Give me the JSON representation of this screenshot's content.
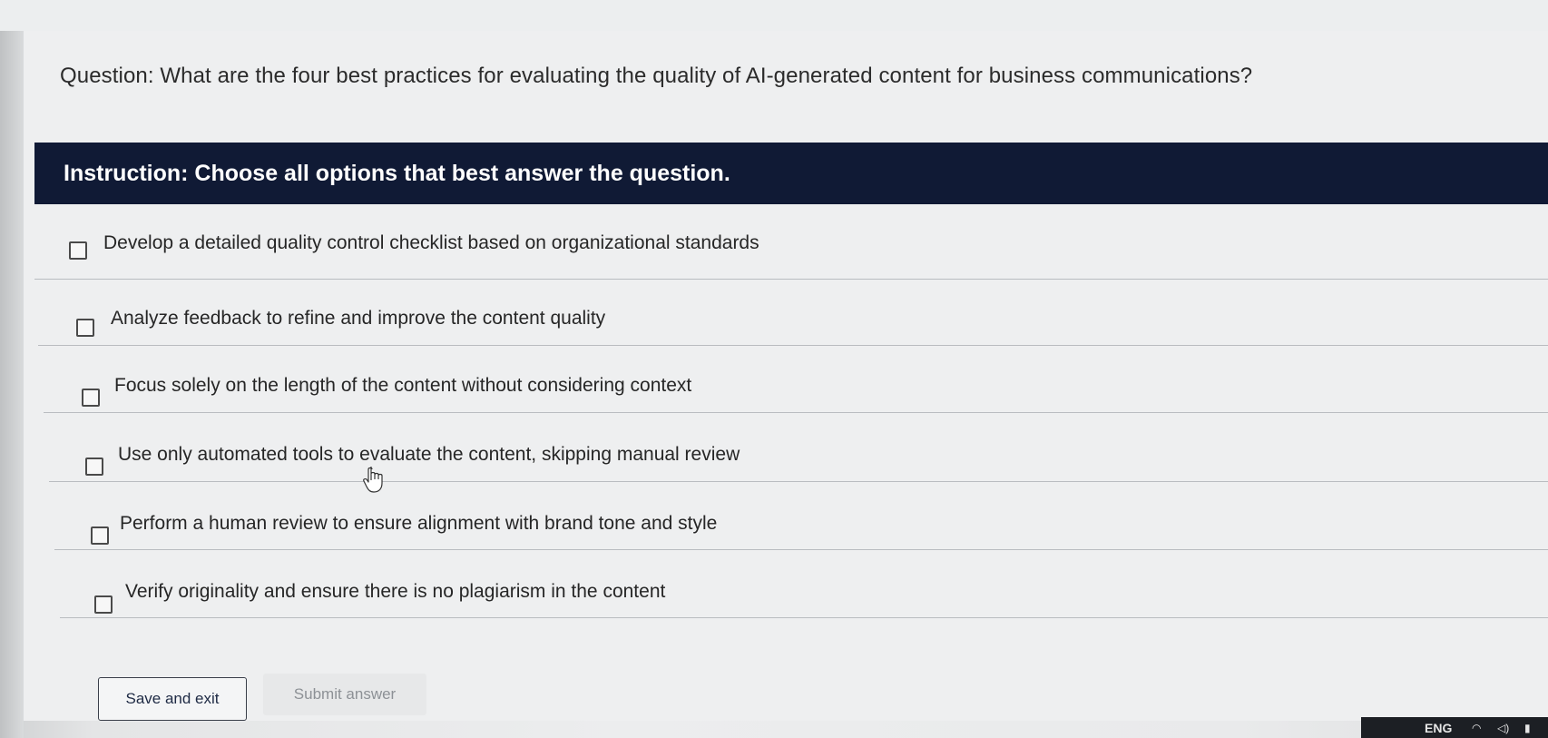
{
  "question": {
    "text": "Question: What are the four best practices for evaluating the quality of AI-generated content for business communications?"
  },
  "instruction": {
    "text": "Instruction: Choose all options that best answer the question."
  },
  "options": [
    {
      "label": "Develop a detailed quality control checklist based on organizational standards",
      "checked": false
    },
    {
      "label": "Analyze feedback to refine and improve the content quality",
      "checked": false
    },
    {
      "label": "Focus solely on the length of the content without considering context",
      "checked": false
    },
    {
      "label": "Use only automated tools to evaluate the content, skipping manual review",
      "checked": false
    },
    {
      "label": "Perform a human review to ensure alignment with brand tone and style",
      "checked": false
    },
    {
      "label": "Verify originality and ensure there is no plagiarism in the content",
      "checked": false
    }
  ],
  "buttons": {
    "save_label": "Save and exit",
    "submit_label": "Submit answer"
  },
  "taskbar": {
    "language": "ENG",
    "icons": [
      "wifi-icon",
      "speaker-icon",
      "battery-icon"
    ]
  },
  "colors": {
    "instruction_bg": "#101a35",
    "instruction_text": "#ffffff",
    "submit_disabled_text": "#8d9196"
  },
  "cursor": {
    "icon": "hand-pointer-icon"
  }
}
